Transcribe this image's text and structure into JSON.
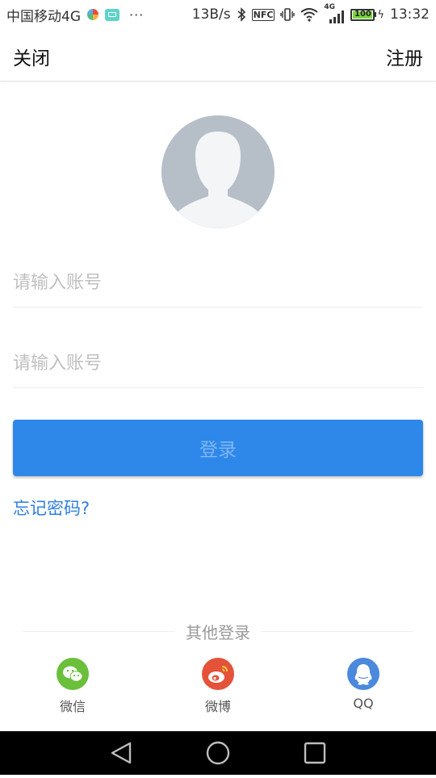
{
  "status_bar": {
    "carrier": "中国移动4G",
    "overflow": "···",
    "net_speed": "13B/s",
    "nfc": "NFC",
    "network_type": "4G",
    "battery": "100",
    "time": "13:32"
  },
  "nav": {
    "close_label": "关闭",
    "register_label": "注册"
  },
  "login_form": {
    "account_placeholder": "请输入账号",
    "password_placeholder": "请输入账号",
    "login_label": "登录",
    "forgot_label": "忘记密码?"
  },
  "other_login": {
    "title": "其他登录",
    "options": [
      {
        "label": "微信",
        "icon": "wechat-icon",
        "color": "#6abf3b"
      },
      {
        "label": "微博",
        "icon": "weibo-icon",
        "color": "#e4523a"
      },
      {
        "label": "QQ",
        "icon": "qq-icon",
        "color": "#4a89dc"
      }
    ]
  },
  "colors": {
    "primary": "#2e88ea",
    "link": "#2e7fe0"
  }
}
